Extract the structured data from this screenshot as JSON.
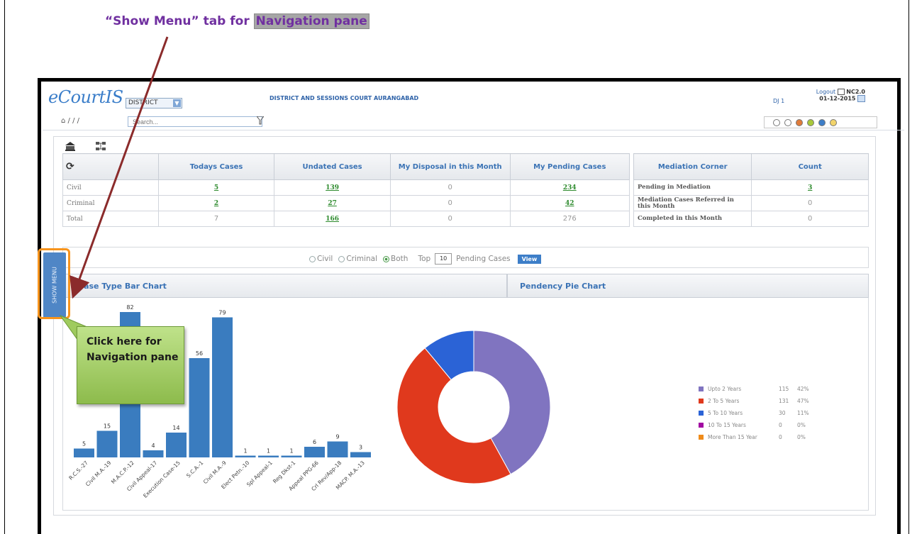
{
  "annotation": {
    "heading_prefix": "“Show Menu” tab for",
    "heading_highlight": "Navigation pane",
    "callout_text": "Click here for Navigation pane"
  },
  "header": {
    "logo": "eCourtIS",
    "district_select": "DISTRICT",
    "court_name": "DISTRICT AND SESSIONS COURT AURANGABAD",
    "user": "DJ 1",
    "logout": "Logout",
    "version": "NC2.0",
    "date": "01-12-2015"
  },
  "toolbar": {
    "breadcrumb": "/ / /",
    "search_placeholder": "Search..."
  },
  "theme_colors": [
    "#ffffff",
    "#ffffff",
    "#e07b39",
    "#a8c83a",
    "#3d7ec8",
    "#f2d46b"
  ],
  "cases_table": {
    "headers": [
      "Todays Cases",
      "Undated Cases",
      "My Disposal in this Month",
      "My Pending Cases"
    ],
    "rows": [
      {
        "label": "Civil",
        "todays": "5",
        "undated": "139",
        "disposal": "0",
        "pending": "234"
      },
      {
        "label": "Criminal",
        "todays": "2",
        "undated": "27",
        "disposal": "0",
        "pending": "42"
      },
      {
        "label": "Total",
        "todays": "7",
        "undated": "166",
        "disposal": "0",
        "pending": "276"
      }
    ]
  },
  "mediation_table": {
    "headers": [
      "Mediation Corner",
      "Count"
    ],
    "rows": [
      {
        "label": "Pending in Mediation",
        "count": "3"
      },
      {
        "label": "Mediation Cases Referred in this Month",
        "count": "0"
      },
      {
        "label": "Completed in this Month",
        "count": "0"
      }
    ]
  },
  "filter_row": {
    "civil": "Civil",
    "criminal": "Criminal",
    "both": "Both",
    "selected": "Both",
    "top_label": "Top",
    "top_value": "10",
    "pending_label": "Pending Cases",
    "view_button": "View"
  },
  "show_menu_label": "SHOW MENU",
  "bar_chart_title": "Case Type Bar Chart",
  "pie_chart_title": "Pendency Pie Chart",
  "chart_data": [
    {
      "type": "bar",
      "title": "Case Type Bar Chart",
      "categories": [
        "R.C.S.-27",
        "Civil M.A.-19",
        "M.A.C.P.-12",
        "Civil Appeal-17",
        "Execution Case-15",
        "S.C.A.-1",
        "Civil M.A.-9",
        "Elect Petn.-10",
        "Spl Appeal-1",
        "Reg Dkst-1",
        "Appeal PPG-66",
        "Crl Rev/App-18",
        "MACP. M.A.-13"
      ],
      "values": [
        5,
        15,
        82,
        4,
        14,
        56,
        79,
        1,
        1,
        1,
        6,
        9,
        3
      ],
      "ylim": [
        0,
        82
      ],
      "color": "#3a7cbf"
    },
    {
      "type": "pie",
      "title": "Pendency Pie Chart",
      "donut": true,
      "slices": [
        {
          "label": "Upto 2 Years",
          "count": 115,
          "percent": "42%",
          "value": 42,
          "color": "#8074c0"
        },
        {
          "label": "2 To 5 Years",
          "count": 131,
          "percent": "47%",
          "value": 47,
          "color": "#e0391d"
        },
        {
          "label": "5 To 10 Years",
          "count": 30,
          "percent": "11%",
          "value": 11,
          "color": "#2b63d6"
        },
        {
          "label": "10 To 15 Years",
          "count": 0,
          "percent": "0%",
          "value": 0,
          "color": "#a10aa1"
        },
        {
          "label": "More Than 15 Year",
          "count": 0,
          "percent": "0%",
          "value": 0,
          "color": "#ef8b1a"
        }
      ]
    }
  ]
}
